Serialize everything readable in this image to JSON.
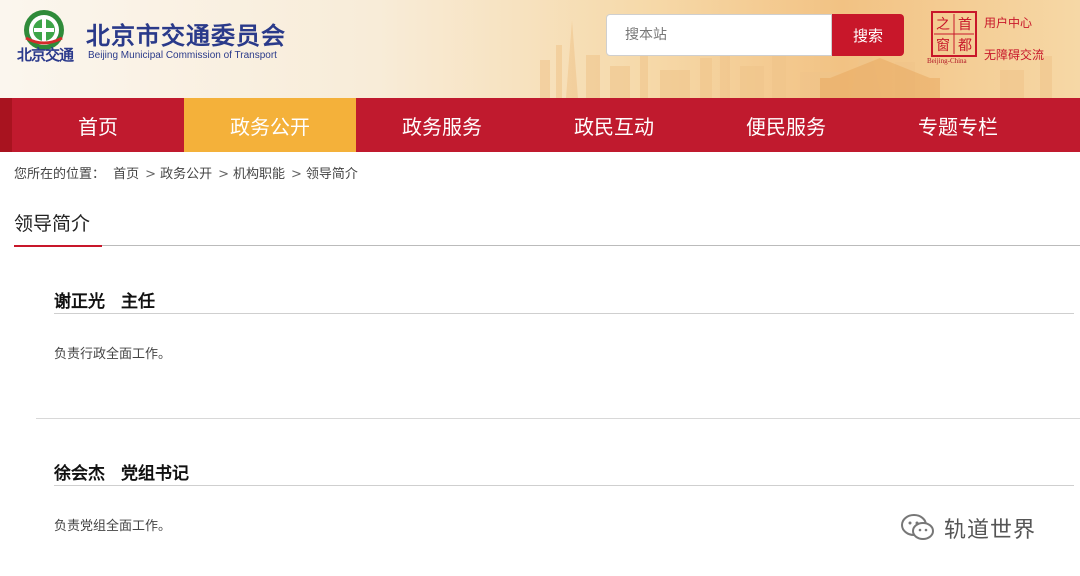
{
  "header": {
    "logo_text": "北京交通",
    "title": "北京市交通委员会",
    "subtitle": "Beijing Municipal Commission of Transport",
    "search": {
      "placeholder": "搜本站",
      "button_label": "搜索"
    },
    "seal_caption": "Beijing-China",
    "seal_chars": [
      "之",
      "首",
      "窗",
      "都"
    ],
    "links": {
      "user_center": "用户中心",
      "accessibility": "无障碍交流"
    }
  },
  "nav": {
    "items": [
      {
        "label": "首页",
        "active": false
      },
      {
        "label": "政务公开",
        "active": true
      },
      {
        "label": "政务服务",
        "active": false
      },
      {
        "label": "政民互动",
        "active": false
      },
      {
        "label": "便民服务",
        "active": false
      },
      {
        "label": "专题专栏",
        "active": false
      }
    ]
  },
  "breadcrumb": {
    "prefix": "您所在的位置：",
    "items": [
      "首页",
      "政务公开",
      "机构职能",
      "领导简介"
    ],
    "separator": ">"
  },
  "section": {
    "title": "领导简介"
  },
  "leaders": [
    {
      "name": "谢正光",
      "title": "主任",
      "description": "负责行政全面工作。"
    },
    {
      "name": "徐会杰",
      "title": "党组书记",
      "description": "负责党组全面工作。"
    }
  ],
  "watermark": {
    "text": "轨道世界"
  },
  "colors": {
    "brand_red": "#c01a2e",
    "active_tab": "#f4b13a",
    "title_blue": "#2a3a8a"
  }
}
